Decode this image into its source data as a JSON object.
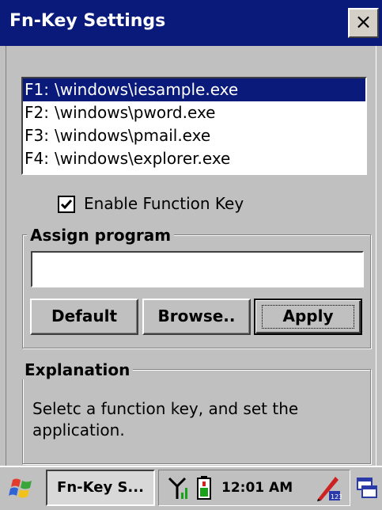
{
  "window": {
    "title": "Fn-Key Settings",
    "close_label": "×"
  },
  "fn_list": {
    "items": [
      {
        "key": "F1:",
        "path": "\\windows\\iesample.exe",
        "selected": true
      },
      {
        "key": "F2:",
        "path": "\\windows\\pword.exe",
        "selected": false
      },
      {
        "key": "F3:",
        "path": "\\windows\\pmail.exe",
        "selected": false
      },
      {
        "key": "F4:",
        "path": "\\windows\\explorer.exe",
        "selected": false
      }
    ]
  },
  "enable_function_key": {
    "label": "Enable Function Key",
    "checked": true
  },
  "assign_program": {
    "legend": "Assign program",
    "input_value": "",
    "buttons": {
      "default": "Default",
      "browse": "Browse..",
      "apply": "Apply"
    }
  },
  "explanation": {
    "legend": "Explanation",
    "text": "Seletc a function key, and set the application."
  },
  "taskbar": {
    "task_button": "Fn-Key S...",
    "clock": "12:01 AM",
    "icons": [
      "start-icon",
      "signal-icon",
      "battery-icon",
      "input-method-icon",
      "desktop-icon"
    ]
  },
  "colors": {
    "titlebar": "#0a1a7a",
    "selection": "#0a1a7a",
    "face": "#c0c0c0"
  }
}
